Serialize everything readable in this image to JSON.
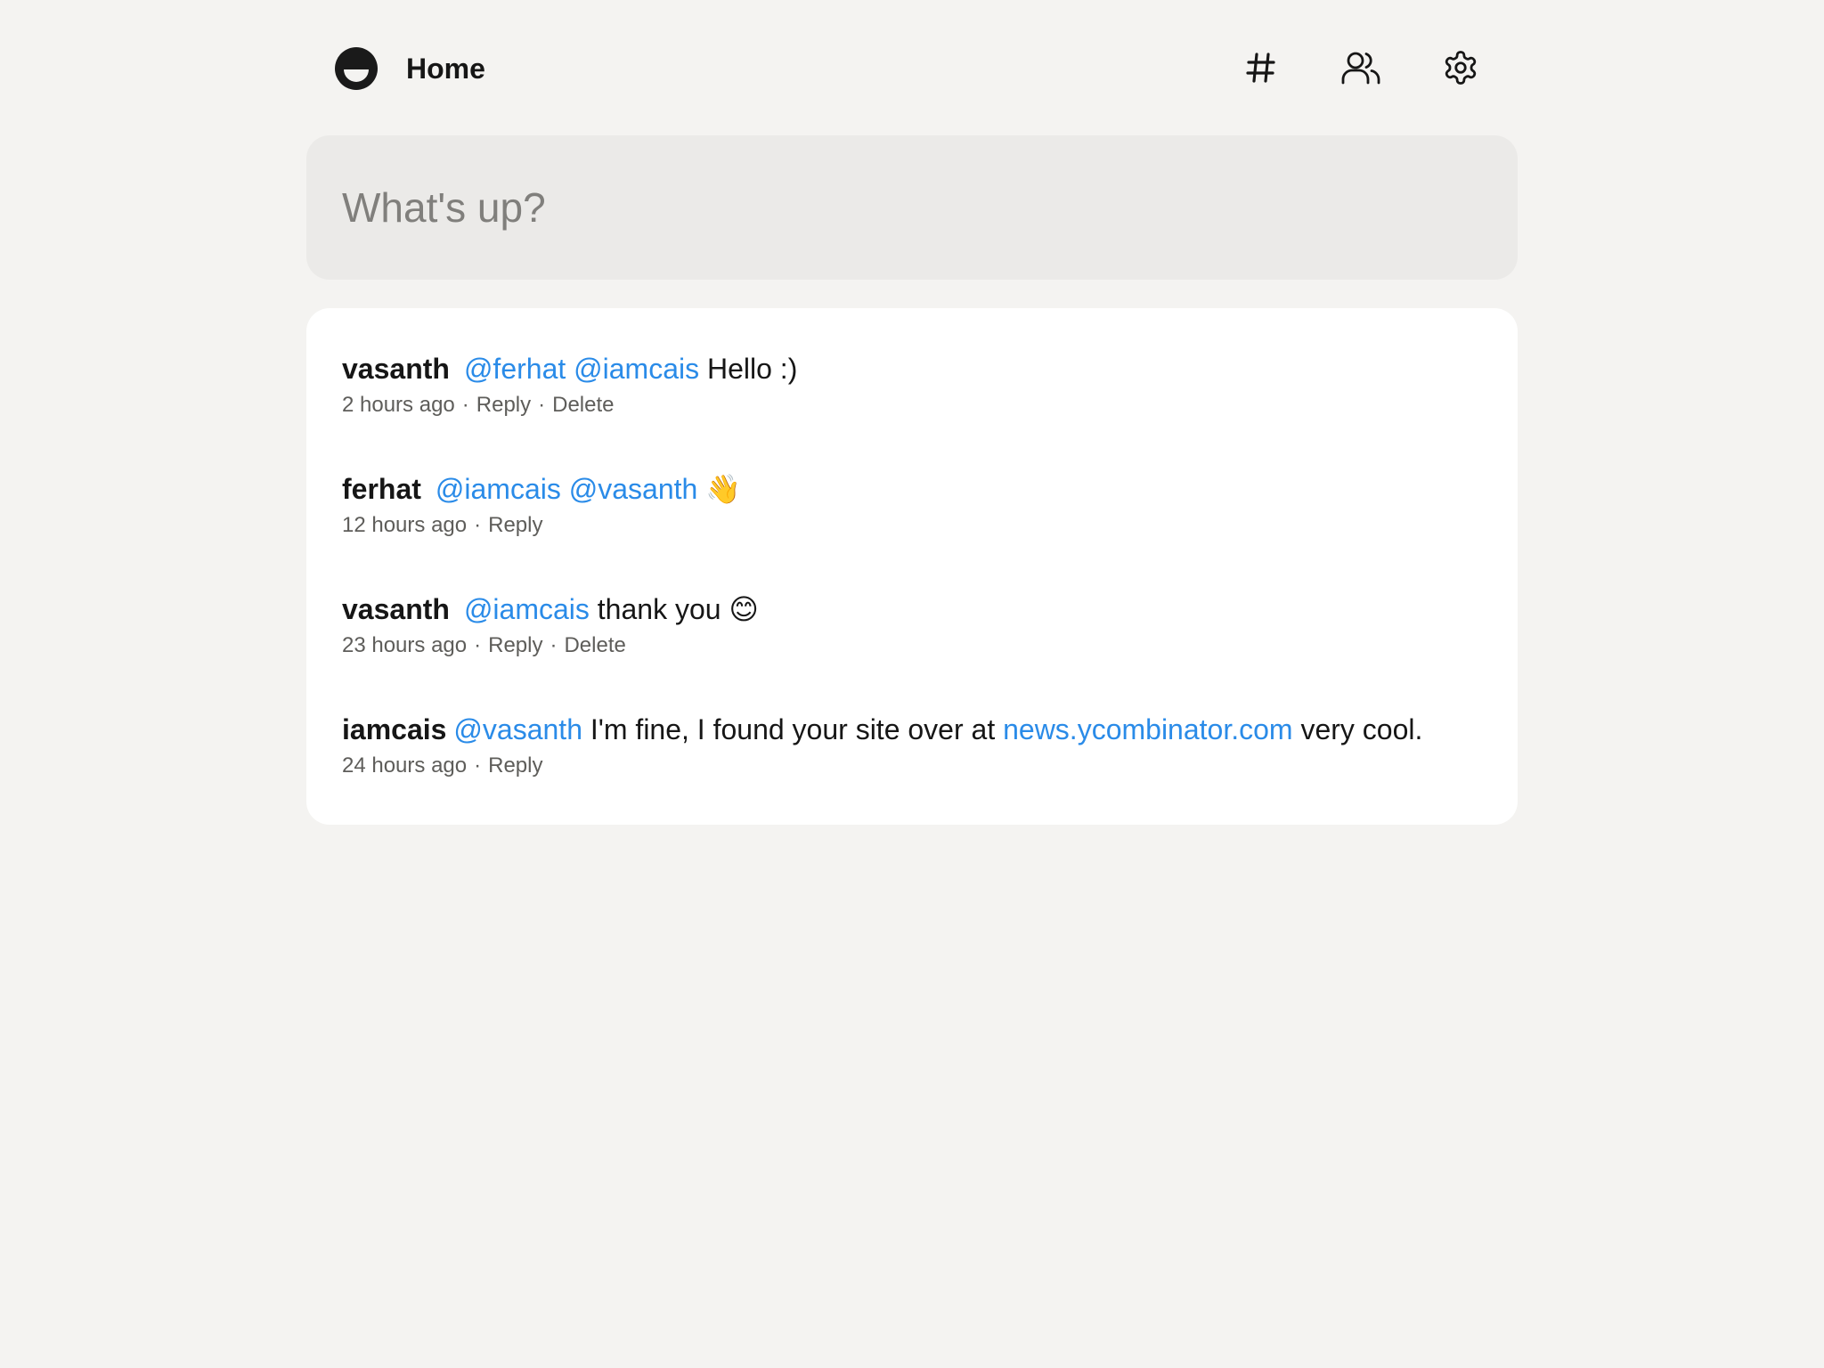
{
  "header": {
    "title": "Home",
    "icons": [
      "logo-icon",
      "hashtag-icon",
      "users-icon",
      "gear-icon"
    ]
  },
  "composer": {
    "placeholder": "What's up?",
    "value": ""
  },
  "colors": {
    "background": "#f4f3f1",
    "composer_bg": "#ebeae8",
    "card_bg": "#ffffff",
    "link": "#2a8be8",
    "meta_text": "#5e5d5a"
  },
  "posts": [
    {
      "author": "vasanth",
      "mention1": "@ferhat",
      "mention2": "@iamcais",
      "text": "Hello :)",
      "time": "2 hours ago",
      "reply": "Reply",
      "delete": "Delete"
    },
    {
      "author": "ferhat",
      "mention1": "@iamcais",
      "mention2": "@vasanth",
      "text": "👋",
      "time": "12 hours ago",
      "reply": "Reply"
    },
    {
      "author": "vasanth",
      "mention1": "@iamcais",
      "text": "thank you 😊",
      "time": "23 hours ago",
      "reply": "Reply",
      "delete": "Delete"
    },
    {
      "author": "iamcais",
      "mention1": "@vasanth",
      "text": "I'm fine, I found your site over at",
      "link": "news.ycombinator.com",
      "text_after": "very cool.",
      "time": "24 hours ago",
      "reply": "Reply"
    }
  ]
}
